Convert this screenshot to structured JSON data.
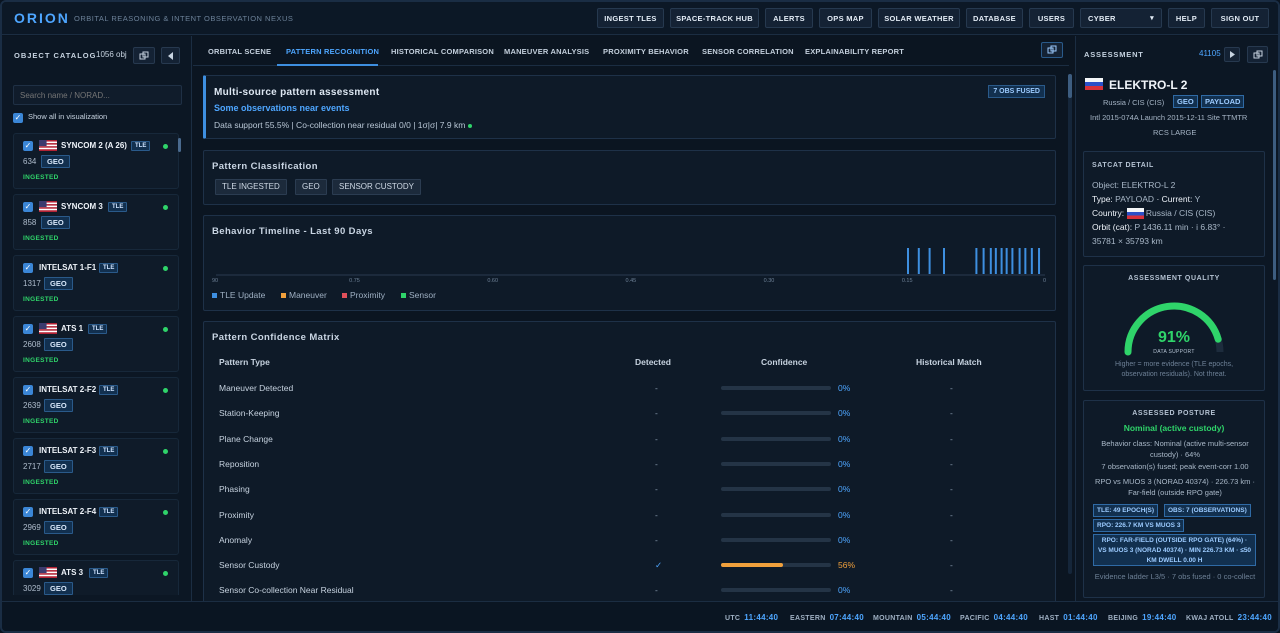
{
  "app": {
    "logo": "ORION",
    "tagline": "ORBITAL REASONING & INTENT OBSERVATION NEXUS"
  },
  "nav": [
    "INGEST TLES",
    "SPACE-TRACK HUB",
    "ALERTS",
    "OPS MAP",
    "SOLAR WEATHER",
    "DATABASE",
    "USERS"
  ],
  "nav_select": {
    "value": "CYBER",
    "arrow": "▾"
  },
  "nav_right": [
    "HELP",
    "SIGN OUT"
  ],
  "catalog": {
    "title": "OBJECT CATALOG",
    "count": "1056 obj",
    "search_placeholder": "Search name / NORAD...",
    "show_all": "Show all in visualization",
    "items": [
      {
        "name": "SYNCOM 2 (A 26)",
        "flag": "us",
        "num": "634",
        "orbit": "GEO",
        "status": "INGESTED",
        "tle": "TLE"
      },
      {
        "name": "SYNCOM 3",
        "flag": "us",
        "num": "858",
        "orbit": "GEO",
        "status": "INGESTED",
        "tle": "TLE"
      },
      {
        "name": "INTELSAT 1-F1",
        "flag": "",
        "num": "1317",
        "orbit": "GEO",
        "status": "INGESTED",
        "tle": "TLE"
      },
      {
        "name": "ATS 1",
        "flag": "us",
        "num": "2608",
        "orbit": "GEO",
        "status": "INGESTED",
        "tle": "TLE"
      },
      {
        "name": "INTELSAT 2-F2",
        "flag": "",
        "num": "2639",
        "orbit": "GEO",
        "status": "INGESTED",
        "tle": "TLE"
      },
      {
        "name": "INTELSAT 2-F3",
        "flag": "",
        "num": "2717",
        "orbit": "GEO",
        "status": "INGESTED",
        "tle": "TLE"
      },
      {
        "name": "INTELSAT 2-F4",
        "flag": "",
        "num": "2969",
        "orbit": "GEO",
        "status": "INGESTED",
        "tle": "TLE"
      },
      {
        "name": "ATS 3",
        "flag": "us",
        "num": "3029",
        "orbit": "GEO",
        "status": "INGESTED",
        "tle": "TLE"
      }
    ]
  },
  "tabs": [
    "ORBITAL SCENE",
    "PATTERN RECOGNITION",
    "HISTORICAL COMPARISON",
    "MANEUVER ANALYSIS",
    "PROXIMITY BEHAVIOR",
    "SENSOR CORRELATION",
    "EXPLAINABILITY REPORT"
  ],
  "assessment_header": {
    "title": "Multi-source pattern assessment",
    "subtitle": "Some observations near events",
    "detail": "Data support 55.5% | Co-collection near residual 0/0 | 1σ|σ| 7.9 km",
    "badge": "7 OBS FUSED"
  },
  "classification": {
    "title": "Pattern Classification",
    "chips": [
      "TLE INGESTED",
      "GEO",
      "SENSOR CUSTODY"
    ]
  },
  "timeline": {
    "title": "Behavior Timeline - Last 90 Days",
    "ticks": [
      "90",
      "0.75",
      "0.60",
      "0.45",
      "0.30",
      "0.15",
      "0"
    ],
    "legend": [
      {
        "label": "TLE Update",
        "color": "#3e8fe0"
      },
      {
        "label": "Maneuver",
        "color": "#f0a03c"
      },
      {
        "label": "Proximity",
        "color": "#e0505a"
      },
      {
        "label": "Sensor",
        "color": "#2fd46a"
      }
    ],
    "events_days_ago": [
      15,
      13.5,
      12,
      10,
      5.5,
      4.5,
      3.5,
      2.8,
      2,
      1.3,
      0.5,
      -0.5,
      -1.3,
      -2.2,
      -3.2
    ]
  },
  "matrix": {
    "title": "Pattern Confidence Matrix",
    "headers": {
      "type": "Pattern Type",
      "detected": "Detected",
      "confidence": "Confidence",
      "historical": "Historical Match"
    },
    "rows": [
      {
        "name": "Maneuver Detected",
        "detected": "-",
        "confidence": 0,
        "pct": "0%",
        "historical": "-"
      },
      {
        "name": "Station-Keeping",
        "detected": "-",
        "confidence": 0,
        "pct": "0%",
        "historical": "-"
      },
      {
        "name": "Plane Change",
        "detected": "-",
        "confidence": 0,
        "pct": "0%",
        "historical": "-"
      },
      {
        "name": "Reposition",
        "detected": "-",
        "confidence": 0,
        "pct": "0%",
        "historical": "-"
      },
      {
        "name": "Phasing",
        "detected": "-",
        "confidence": 0,
        "pct": "0%",
        "historical": "-"
      },
      {
        "name": "Proximity",
        "detected": "-",
        "confidence": 0,
        "pct": "0%",
        "historical": "-"
      },
      {
        "name": "Anomaly",
        "detected": "-",
        "confidence": 0,
        "pct": "0%",
        "historical": "-"
      },
      {
        "name": "Sensor Custody",
        "detected": "✓",
        "confidence": 56,
        "pct": "56%",
        "historical": "-"
      },
      {
        "name": "Sensor Co-collection Near Residual",
        "detected": "-",
        "confidence": 0,
        "pct": "0%",
        "historical": "-"
      }
    ]
  },
  "assessment": {
    "title": "ASSESSMENT",
    "id": "41105",
    "name": "ELEKTRO-L 2",
    "country": "Russia / CIS (CIS)",
    "tags": [
      "GEO",
      "PAYLOAD"
    ],
    "intl": "Intl 2015-074A  Launch 2015-12-11  Site TTMTR",
    "rcs": "RCS LARGE",
    "satcat": {
      "title": "SATCAT DETAIL",
      "object": "ELEKTRO-L 2",
      "type": "PAYLOAD",
      "current": "Y",
      "country": "Russia / CIS (CIS)",
      "orbit_line1": "P 1436.11 min · i 6.83° ·",
      "orbit_line2": "35781 × 35793 km",
      "labels": {
        "object": "Object:",
        "type": "Type:",
        "current": "Current:",
        "country": "Country:",
        "orbit": "Orbit (cat):"
      }
    },
    "quality": {
      "title": "ASSESSMENT QUALITY",
      "value": 91,
      "display": "91%",
      "label": "DATA SUPPORT",
      "note": "Higher = more evidence (TLE epochs, observation residuals). Not threat."
    },
    "posture": {
      "title": "ASSESSED POSTURE",
      "status": "Nominal (active custody)",
      "behavior": "Behavior class: Nominal (active multi-sensor custody) · 64%",
      "fused": "7 observation(s) fused; peak event-corr 1.00",
      "rpo": "RPO vs MUOS 3 (NORAD 40374) · 226.73 km · Far-field (outside RPO gate)",
      "tags": [
        "TLE: 49 EPOCH(S)",
        "OBS: 7 (OBSERVATIONS)",
        "RPO: 226.7 KM VS MUOS 3"
      ],
      "rpo_tag": "RPO: FAR-FIELD (OUTSIDE RPO GATE) (64%) · VS MUOS 3 (NORAD 40374) · MIN 226.73 KM · ≤50 KM DWELL 0.00 H",
      "ladder": "Evidence ladder L3/5 · 7 obs fused · 0 co-collect"
    }
  },
  "clocks": [
    {
      "zone": "UTC",
      "time": "11:44:40"
    },
    {
      "zone": "EASTERN",
      "time": "07:44:40"
    },
    {
      "zone": "MOUNTAIN",
      "time": "05:44:40"
    },
    {
      "zone": "PACIFIC",
      "time": "04:44:40"
    },
    {
      "zone": "HAST",
      "time": "01:44:40"
    },
    {
      "zone": "BEIJING",
      "time": "19:44:40"
    },
    {
      "zone": "KWAJ ATOLL",
      "time": "23:44:40"
    }
  ],
  "colors": {
    "accent": "#4ea6ff",
    "ok": "#2fd46a",
    "warn": "#f0a03c"
  }
}
